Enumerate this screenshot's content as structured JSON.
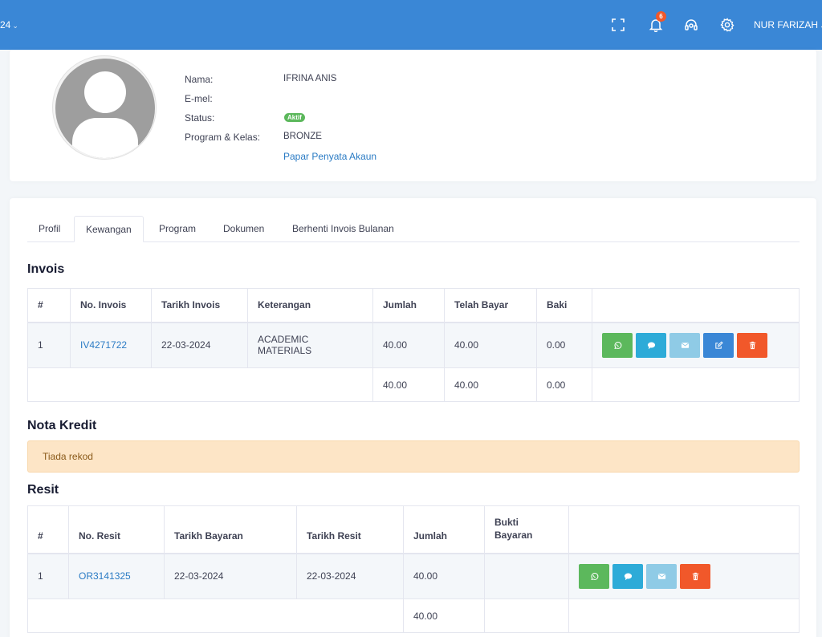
{
  "topbar": {
    "left_text": "24",
    "notification_count": "6",
    "user_name": "NUR FARIZAH"
  },
  "profile": {
    "labels": {
      "name": "Nama:",
      "email": "E-mel:",
      "status": "Status:",
      "program": "Program & Kelas:"
    },
    "name": "IFRINA ANIS",
    "email": "",
    "status": "Aktif",
    "program": "BRONZE",
    "statement_link": "Papar Penyata Akaun"
  },
  "tabs": [
    {
      "label": "Profil"
    },
    {
      "label": "Kewangan"
    },
    {
      "label": "Program"
    },
    {
      "label": "Dokumen"
    },
    {
      "label": "Berhenti Invois Bulanan"
    }
  ],
  "invoice": {
    "title": "Invois",
    "headers": [
      "#",
      "No. Invois",
      "Tarikh Invois",
      "Keterangan",
      "Jumlah",
      "Telah Bayar",
      "Baki",
      ""
    ],
    "rows": [
      {
        "no": "1",
        "invoice_no": "IV4271722",
        "date": "22-03-2024",
        "desc": "ACADEMIC MATERIALS",
        "amount": "40.00",
        "paid": "40.00",
        "balance": "0.00"
      }
    ],
    "totals": {
      "amount": "40.00",
      "paid": "40.00",
      "balance": "0.00"
    }
  },
  "credit_note": {
    "title": "Nota Kredit",
    "empty": "Tiada rekod"
  },
  "receipt": {
    "title": "Resit",
    "headers": [
      "#",
      "No. Resit",
      "Tarikh Bayaran",
      "Tarikh Resit",
      "Jumlah",
      "Bukti Bayaran",
      ""
    ],
    "rows": [
      {
        "no": "1",
        "receipt_no": "OR3141325",
        "pay_date": "22-03-2024",
        "receipt_date": "22-03-2024",
        "amount": "40.00",
        "proof": ""
      }
    ],
    "totals": {
      "amount": "40.00"
    }
  },
  "colors": {
    "topbar": "#3a87d6",
    "whatsapp": "#5cb85c",
    "sms": "#2dabd8",
    "email": "#8fcbe6",
    "edit": "#3a87d6",
    "delete": "#f1582a"
  }
}
